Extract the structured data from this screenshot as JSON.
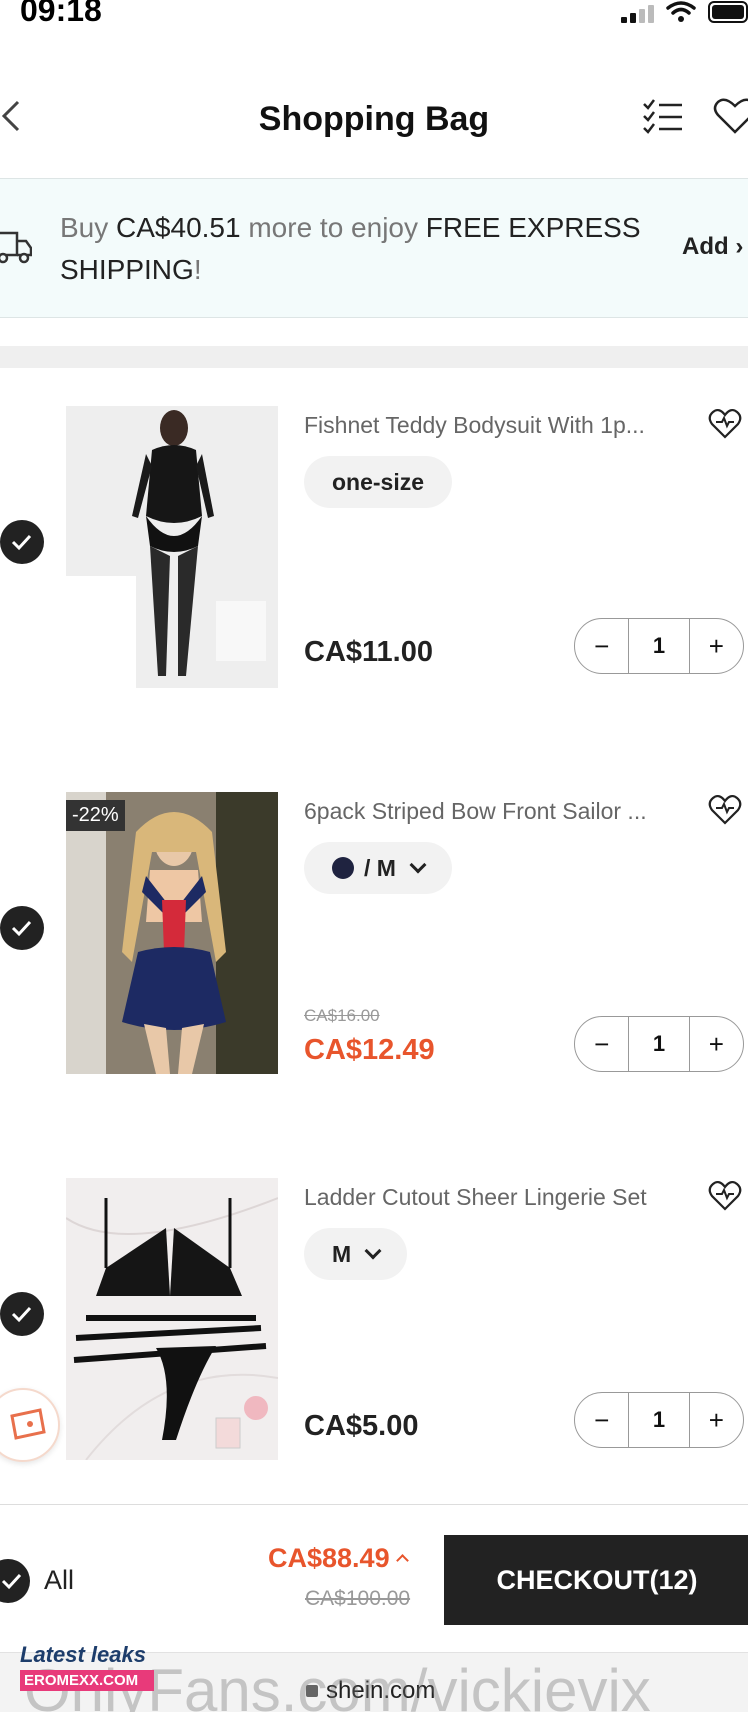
{
  "status": {
    "time": "09:18"
  },
  "nav": {
    "title": "Shopping Bag"
  },
  "banner": {
    "prefix": "Buy ",
    "amount": "CA$40.51",
    "middle": " more to enjoy ",
    "highlight": "FREE EXPRESS SHIPPING",
    "suffix": "!",
    "action": "Add"
  },
  "items": [
    {
      "name": "Fishnet Teddy Bodysuit With 1p...",
      "variant": "one-size",
      "price": "CA$11.00",
      "qty": "1"
    },
    {
      "name": "6pack Striped Bow Front Sailor ...",
      "discount": "-22%",
      "variant": "/ M",
      "original_price": "CA$16.00",
      "price": "CA$12.49",
      "qty": "1"
    },
    {
      "name": "Ladder Cutout Sheer Lingerie Set",
      "variant": "M",
      "price": "CA$5.00",
      "qty": "1"
    }
  ],
  "footer": {
    "all_label": "All",
    "total": "CA$88.49",
    "original_total": "CA$100.00",
    "checkout_label": "CHECKOUT(12)"
  },
  "browser": {
    "url": "shein.com"
  },
  "overlay": {
    "watermark": "OnlyFans.com/vickievix",
    "badge_top": "Latest leaks",
    "badge_bottom": "EROMEXX.COM"
  },
  "colors": {
    "sale": "#e8552c",
    "dark": "#222222",
    "banner_bg": "#f3fbfb"
  }
}
